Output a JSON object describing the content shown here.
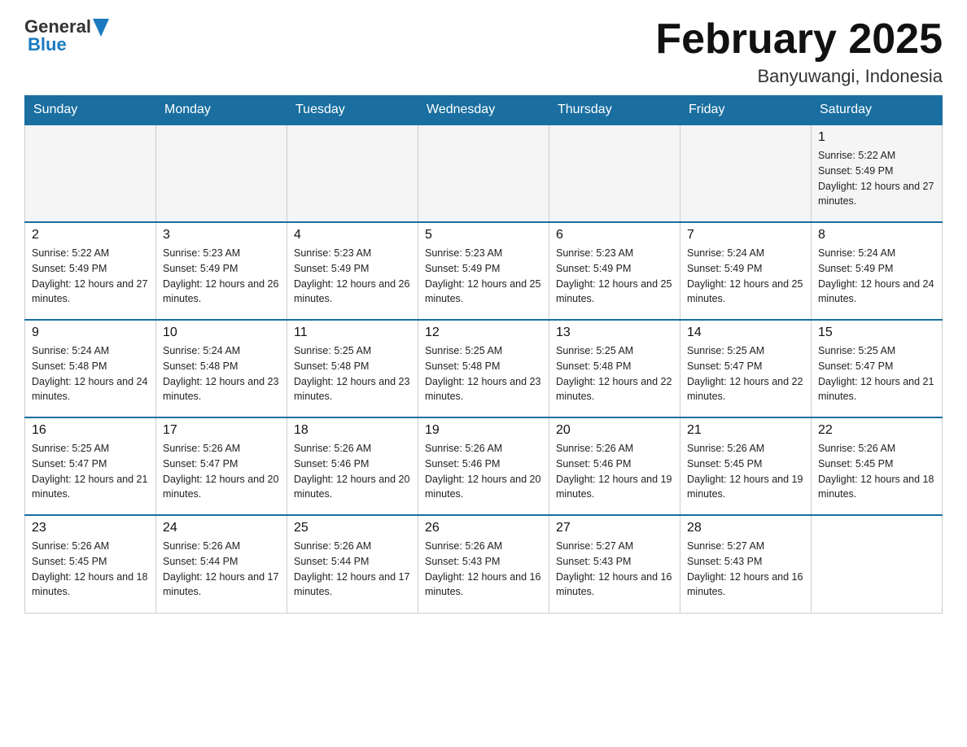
{
  "header": {
    "logo_general": "General",
    "logo_blue": "Blue",
    "month_title": "February 2025",
    "location": "Banyuwangi, Indonesia"
  },
  "days_of_week": [
    "Sunday",
    "Monday",
    "Tuesday",
    "Wednesday",
    "Thursday",
    "Friday",
    "Saturday"
  ],
  "weeks": [
    [
      {
        "day": "",
        "sunrise": "",
        "sunset": "",
        "daylight": ""
      },
      {
        "day": "",
        "sunrise": "",
        "sunset": "",
        "daylight": ""
      },
      {
        "day": "",
        "sunrise": "",
        "sunset": "",
        "daylight": ""
      },
      {
        "day": "",
        "sunrise": "",
        "sunset": "",
        "daylight": ""
      },
      {
        "day": "",
        "sunrise": "",
        "sunset": "",
        "daylight": ""
      },
      {
        "day": "",
        "sunrise": "",
        "sunset": "",
        "daylight": ""
      },
      {
        "day": "1",
        "sunrise": "Sunrise: 5:22 AM",
        "sunset": "Sunset: 5:49 PM",
        "daylight": "Daylight: 12 hours and 27 minutes."
      }
    ],
    [
      {
        "day": "2",
        "sunrise": "Sunrise: 5:22 AM",
        "sunset": "Sunset: 5:49 PM",
        "daylight": "Daylight: 12 hours and 27 minutes."
      },
      {
        "day": "3",
        "sunrise": "Sunrise: 5:23 AM",
        "sunset": "Sunset: 5:49 PM",
        "daylight": "Daylight: 12 hours and 26 minutes."
      },
      {
        "day": "4",
        "sunrise": "Sunrise: 5:23 AM",
        "sunset": "Sunset: 5:49 PM",
        "daylight": "Daylight: 12 hours and 26 minutes."
      },
      {
        "day": "5",
        "sunrise": "Sunrise: 5:23 AM",
        "sunset": "Sunset: 5:49 PM",
        "daylight": "Daylight: 12 hours and 25 minutes."
      },
      {
        "day": "6",
        "sunrise": "Sunrise: 5:23 AM",
        "sunset": "Sunset: 5:49 PM",
        "daylight": "Daylight: 12 hours and 25 minutes."
      },
      {
        "day": "7",
        "sunrise": "Sunrise: 5:24 AM",
        "sunset": "Sunset: 5:49 PM",
        "daylight": "Daylight: 12 hours and 25 minutes."
      },
      {
        "day": "8",
        "sunrise": "Sunrise: 5:24 AM",
        "sunset": "Sunset: 5:49 PM",
        "daylight": "Daylight: 12 hours and 24 minutes."
      }
    ],
    [
      {
        "day": "9",
        "sunrise": "Sunrise: 5:24 AM",
        "sunset": "Sunset: 5:48 PM",
        "daylight": "Daylight: 12 hours and 24 minutes."
      },
      {
        "day": "10",
        "sunrise": "Sunrise: 5:24 AM",
        "sunset": "Sunset: 5:48 PM",
        "daylight": "Daylight: 12 hours and 23 minutes."
      },
      {
        "day": "11",
        "sunrise": "Sunrise: 5:25 AM",
        "sunset": "Sunset: 5:48 PM",
        "daylight": "Daylight: 12 hours and 23 minutes."
      },
      {
        "day": "12",
        "sunrise": "Sunrise: 5:25 AM",
        "sunset": "Sunset: 5:48 PM",
        "daylight": "Daylight: 12 hours and 23 minutes."
      },
      {
        "day": "13",
        "sunrise": "Sunrise: 5:25 AM",
        "sunset": "Sunset: 5:48 PM",
        "daylight": "Daylight: 12 hours and 22 minutes."
      },
      {
        "day": "14",
        "sunrise": "Sunrise: 5:25 AM",
        "sunset": "Sunset: 5:47 PM",
        "daylight": "Daylight: 12 hours and 22 minutes."
      },
      {
        "day": "15",
        "sunrise": "Sunrise: 5:25 AM",
        "sunset": "Sunset: 5:47 PM",
        "daylight": "Daylight: 12 hours and 21 minutes."
      }
    ],
    [
      {
        "day": "16",
        "sunrise": "Sunrise: 5:25 AM",
        "sunset": "Sunset: 5:47 PM",
        "daylight": "Daylight: 12 hours and 21 minutes."
      },
      {
        "day": "17",
        "sunrise": "Sunrise: 5:26 AM",
        "sunset": "Sunset: 5:47 PM",
        "daylight": "Daylight: 12 hours and 20 minutes."
      },
      {
        "day": "18",
        "sunrise": "Sunrise: 5:26 AM",
        "sunset": "Sunset: 5:46 PM",
        "daylight": "Daylight: 12 hours and 20 minutes."
      },
      {
        "day": "19",
        "sunrise": "Sunrise: 5:26 AM",
        "sunset": "Sunset: 5:46 PM",
        "daylight": "Daylight: 12 hours and 20 minutes."
      },
      {
        "day": "20",
        "sunrise": "Sunrise: 5:26 AM",
        "sunset": "Sunset: 5:46 PM",
        "daylight": "Daylight: 12 hours and 19 minutes."
      },
      {
        "day": "21",
        "sunrise": "Sunrise: 5:26 AM",
        "sunset": "Sunset: 5:45 PM",
        "daylight": "Daylight: 12 hours and 19 minutes."
      },
      {
        "day": "22",
        "sunrise": "Sunrise: 5:26 AM",
        "sunset": "Sunset: 5:45 PM",
        "daylight": "Daylight: 12 hours and 18 minutes."
      }
    ],
    [
      {
        "day": "23",
        "sunrise": "Sunrise: 5:26 AM",
        "sunset": "Sunset: 5:45 PM",
        "daylight": "Daylight: 12 hours and 18 minutes."
      },
      {
        "day": "24",
        "sunrise": "Sunrise: 5:26 AM",
        "sunset": "Sunset: 5:44 PM",
        "daylight": "Daylight: 12 hours and 17 minutes."
      },
      {
        "day": "25",
        "sunrise": "Sunrise: 5:26 AM",
        "sunset": "Sunset: 5:44 PM",
        "daylight": "Daylight: 12 hours and 17 minutes."
      },
      {
        "day": "26",
        "sunrise": "Sunrise: 5:26 AM",
        "sunset": "Sunset: 5:43 PM",
        "daylight": "Daylight: 12 hours and 16 minutes."
      },
      {
        "day": "27",
        "sunrise": "Sunrise: 5:27 AM",
        "sunset": "Sunset: 5:43 PM",
        "daylight": "Daylight: 12 hours and 16 minutes."
      },
      {
        "day": "28",
        "sunrise": "Sunrise: 5:27 AM",
        "sunset": "Sunset: 5:43 PM",
        "daylight": "Daylight: 12 hours and 16 minutes."
      },
      {
        "day": "",
        "sunrise": "",
        "sunset": "",
        "daylight": ""
      }
    ]
  ]
}
